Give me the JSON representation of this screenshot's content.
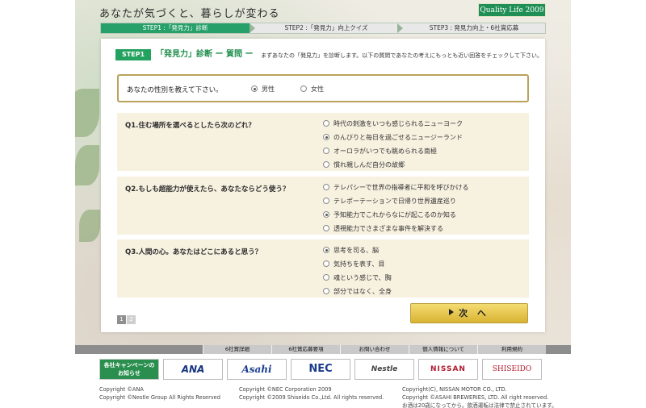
{
  "header": {
    "tagline": "あなたが気づくと、暮らしが変わる",
    "brand": "Quality Life 2009"
  },
  "steps": [
    {
      "label": "STEP1 :「発見力」診断",
      "active": true
    },
    {
      "label": "STEP2 :「発見力」向上クイズ",
      "active": false
    },
    {
      "label": "STEP3 : 発見力向上・6社賞応募",
      "active": false
    }
  ],
  "diagnosis": {
    "step_tag": "STEP1",
    "title": "「発見力」診断 ー 質問 ー",
    "description": "まずあなたの「発見力」を診断します。以下の質問であなたの考えにもっとも近い回答をチェックして下さい。"
  },
  "gender": {
    "question": "あなたの性別を教えて下さい。",
    "options": [
      {
        "label": "男性",
        "selected": true
      },
      {
        "label": "女性",
        "selected": false
      }
    ]
  },
  "questions": [
    {
      "title": "Q1.住む場所を選べるとしたら次のどれ？",
      "options": [
        {
          "label": "時代の刺激をいつも感じられるニューヨーク",
          "selected": false
        },
        {
          "label": "のんびりと毎日を過ごせるニュージーランド",
          "selected": true
        },
        {
          "label": "オーロラがいつでも眺められる南極",
          "selected": false
        },
        {
          "label": "慣れ親しんだ自分の故郷",
          "selected": false
        }
      ]
    },
    {
      "title": "Q2.もしも超能力が使えたら、あなたならどう使う？",
      "options": [
        {
          "label": "テレパシーで世界の指導者に平和を呼びかける",
          "selected": false
        },
        {
          "label": "テレポーテーションで日帰り世界遺産巡り",
          "selected": false
        },
        {
          "label": "予知能力でこれからなにが起こるのか知る",
          "selected": true
        },
        {
          "label": "透視能力でさまざまな事件を解決する",
          "selected": false
        }
      ]
    },
    {
      "title": "Q3.人間の心。あなたはどこにあると思う？",
      "options": [
        {
          "label": "思考を司る、脳",
          "selected": true
        },
        {
          "label": "気持ちを表す、目",
          "selected": false
        },
        {
          "label": "魂という感じで、胸",
          "selected": false
        },
        {
          "label": "部分ではなく、全身",
          "selected": false
        }
      ]
    }
  ],
  "pager": {
    "current": "1",
    "next": "2"
  },
  "next_button": {
    "label": "次 へ"
  },
  "footer_nav": [
    "6社賞詳細",
    "6社賞応募要項",
    "お問い合わせ",
    "個人情報について",
    "利用規約"
  ],
  "sponsors": {
    "campaign": [
      "各社キャンペーンの",
      "お知らせ"
    ],
    "logos": [
      "ANA",
      "Asahi",
      "NEC",
      "Nestle",
      "NISSAN",
      "SHISEIDO"
    ]
  },
  "copyright": [
    "Copyright ©ANA",
    "Copyright ©Nestle Group All Rights Reserved",
    "Copyright ©NEC Corporation 2009",
    "Copyright ©2009 Shiseido Co.,Ltd. All rights reserved.",
    "Copyright(C), NISSAN MOTOR CO., LTD.",
    "Copyright ©ASAHI BREWERIES, LTD. All right reserved.",
    "お酒は20歳になってから。飲酒運転は法律で禁止されています。"
  ],
  "colors": {
    "accent_green": "#23a15e",
    "gold_border": "#b9a25a",
    "question_bg": "#f7f1e0",
    "button_gold": "#e6c44f"
  }
}
